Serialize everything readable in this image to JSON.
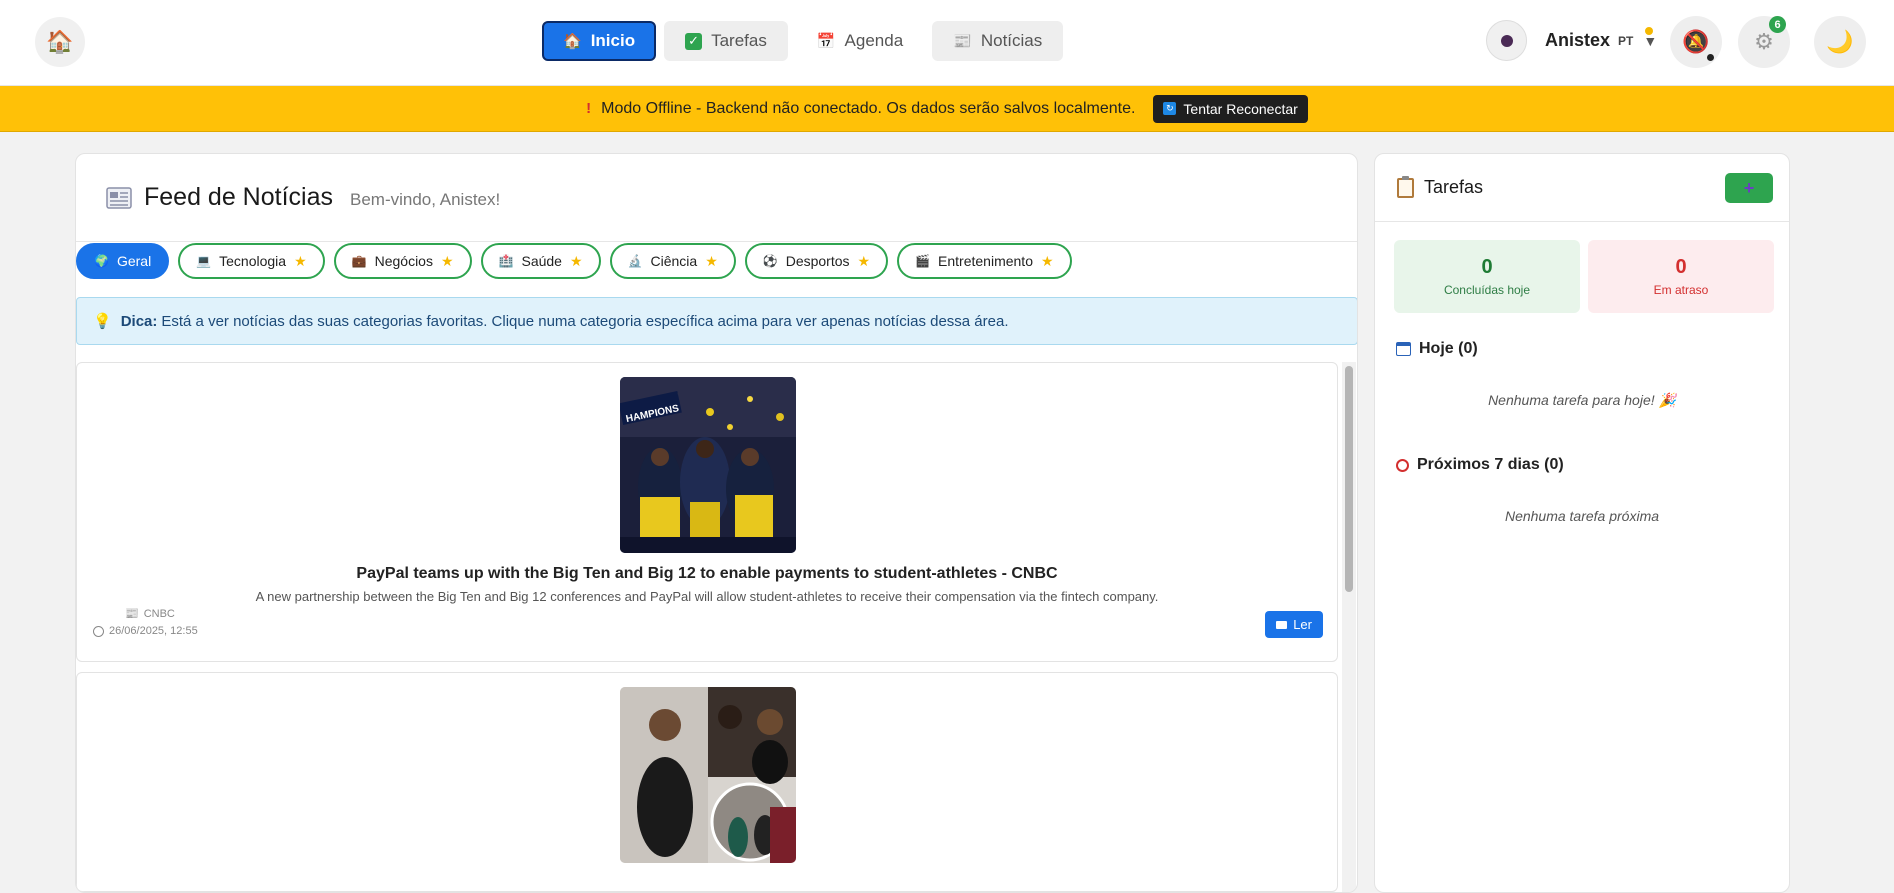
{
  "nav": {
    "home_icon": "house-icon",
    "items": [
      {
        "label": "Inicio",
        "icon": "house-icon",
        "active": true
      },
      {
        "label": "Tarefas",
        "icon": "check-box-icon"
      },
      {
        "label": "Agenda",
        "icon": "calendar-icon"
      },
      {
        "label": "Notícias",
        "icon": "newspaper-icon"
      }
    ]
  },
  "user": {
    "name": "Anistex",
    "lang": "PT"
  },
  "header_actions": {
    "notifications_icon": "bell-off-icon",
    "settings_icon": "gear-icon",
    "settings_badge": "6",
    "theme_icon": "moon-icon"
  },
  "banner": {
    "text": "Modo Offline - Backend não conectado. Os dados serão salvos localmente.",
    "button": "Tentar Reconectar",
    "color": "#ffc107"
  },
  "news": {
    "title": "Feed de Notícias",
    "welcome": "Bem-vindo, Anistex!",
    "categories": [
      {
        "label": "Geral",
        "active": true
      },
      {
        "label": "Tecnologia"
      },
      {
        "label": "Negócios"
      },
      {
        "label": "Saúde"
      },
      {
        "label": "Ciência"
      },
      {
        "label": "Desportos"
      },
      {
        "label": "Entretenimento"
      }
    ],
    "tip_label": "Dica:",
    "tip_text": "Está a ver notícias das suas categorias favoritas. Clique numa categoria específica acima para ver apenas notícias dessa área.",
    "articles": [
      {
        "title": "PayPal teams up with the Big Ten and Big 12 to enable payments to student-athletes - CNBC",
        "description": "A new partnership between the Big Ten and Big 12 conferences and PayPal will allow student-athletes to receive their compensation via the fintech company.",
        "source": "CNBC",
        "date": "26/06/2025, 12:55",
        "read_label": "Ler"
      }
    ]
  },
  "tasks": {
    "title": "Tarefas",
    "add_label": "+",
    "done_count": "0",
    "done_label": "Concluídas hoje",
    "late_count": "0",
    "late_label": "Em atraso",
    "today_header": "Hoje (0)",
    "today_empty": "Nenhuma tarefa para hoje! 🎉",
    "next_header": "Próximos 7 dias (0)",
    "next_empty": "Nenhuma tarefa próxima"
  }
}
